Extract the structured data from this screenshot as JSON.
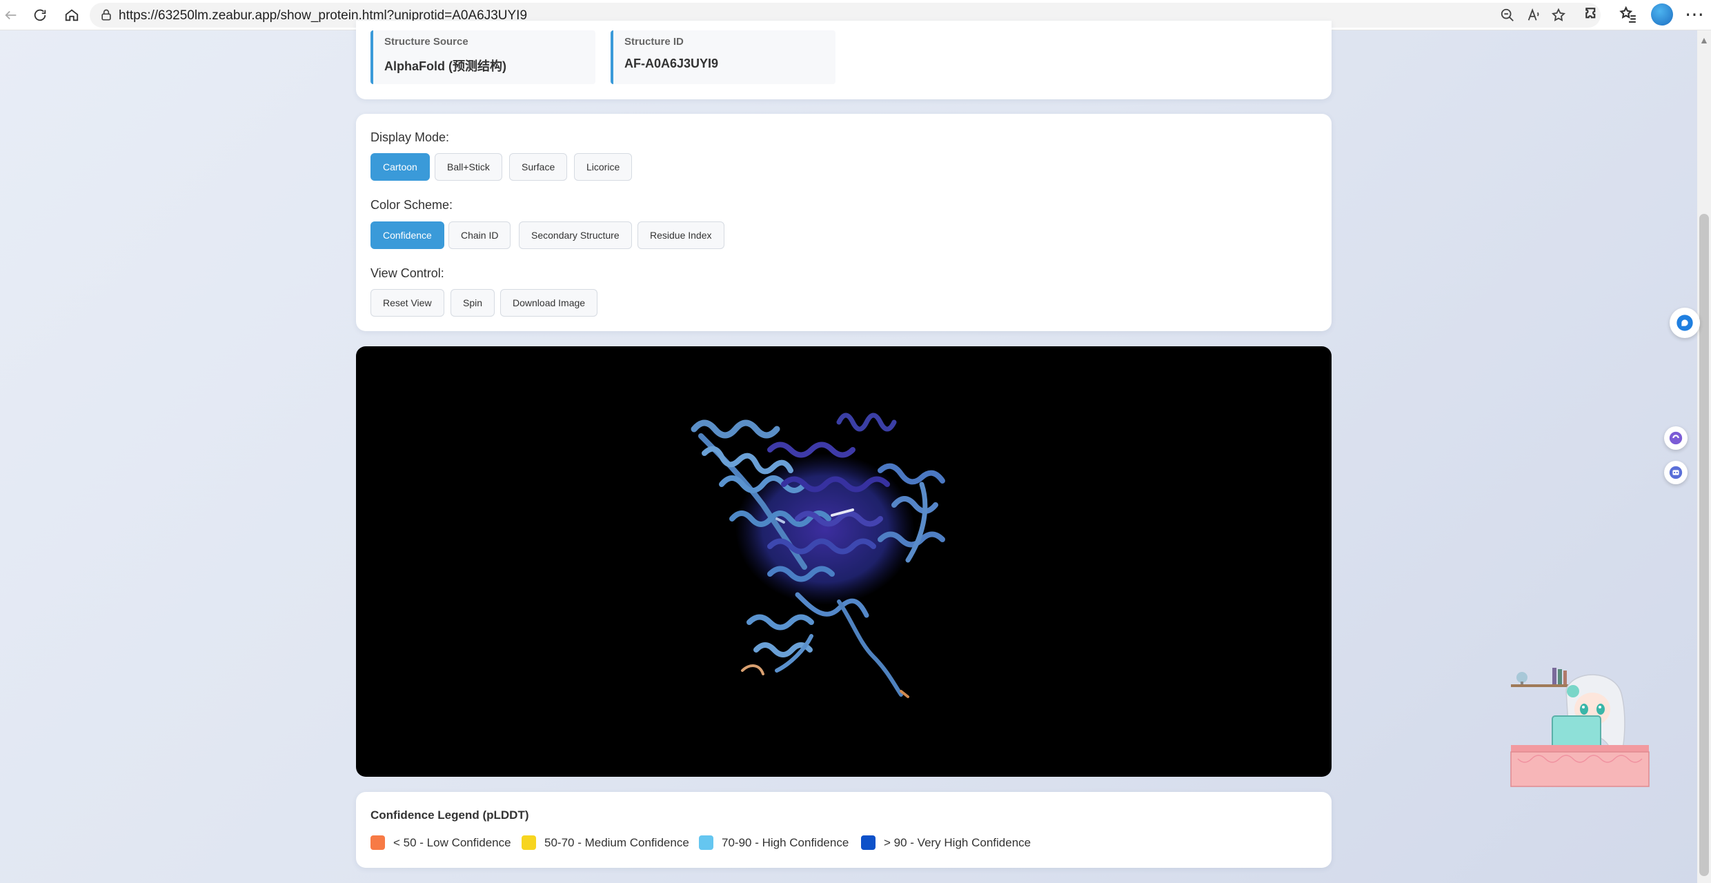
{
  "browser": {
    "url": "https://63250lm.zeabur.app/show_protein.html?uniprotid=A0A6J3UYI9"
  },
  "structure_info": {
    "source_label": "Structure Source",
    "source_value": "AlphaFold (预测结构)",
    "id_label": "Structure ID",
    "id_value": "AF-A0A6J3UYI9"
  },
  "controls": {
    "display_mode_label": "Display Mode:",
    "display_modes": [
      "Cartoon",
      "Ball+Stick",
      "Surface",
      "Licorice"
    ],
    "color_scheme_label": "Color Scheme:",
    "color_schemes": [
      "Confidence",
      "Chain ID",
      "Secondary Structure",
      "Residue Index"
    ],
    "view_control_label": "View Control:",
    "view_controls": [
      "Reset View",
      "Spin",
      "Download Image"
    ]
  },
  "legend": {
    "title": "Confidence Legend (pLDDT)",
    "items": [
      {
        "label": "< 50 - Low Confidence",
        "color": "#f77a45"
      },
      {
        "label": "50-70 - Medium Confidence",
        "color": "#f7d520"
      },
      {
        "label": "70-90 - High Confidence",
        "color": "#65c6f0"
      },
      {
        "label": "> 90 - Very High Confidence",
        "color": "#0d51c9"
      }
    ]
  },
  "colors": {
    "accent": "#3a9ad9",
    "viewer_bg": "#000000"
  }
}
